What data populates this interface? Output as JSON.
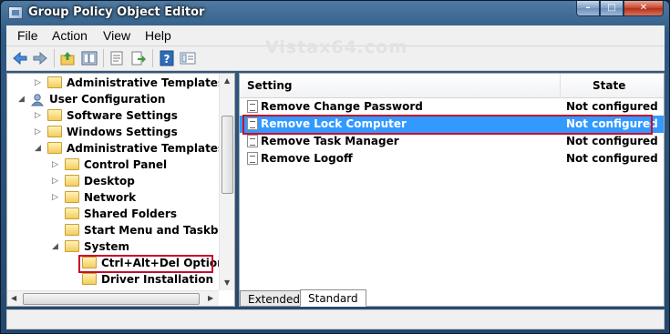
{
  "window": {
    "title": "Group Policy Object Editor",
    "watermark": "Vistax64.com",
    "caption_buttons": {
      "minimize": "–",
      "maximize": "□",
      "close": "✕"
    }
  },
  "menu": [
    "File",
    "Action",
    "View",
    "Help"
  ],
  "toolbar": [
    "back-icon",
    "forward-icon",
    "up-folder-icon",
    "show-hide-tree-icon",
    "properties-icon",
    "export-list-icon",
    "help-icon",
    "extended-view-icon"
  ],
  "tree": {
    "items": [
      {
        "label": "Administrative Templates",
        "expander": "▷",
        "icon": "folder"
      },
      {
        "label": "User Configuration",
        "expander": "◢",
        "icon": "user-config"
      },
      {
        "label": "Software Settings",
        "expander": "▷",
        "icon": "folder"
      },
      {
        "label": "Windows Settings",
        "expander": "▷",
        "icon": "folder"
      },
      {
        "label": "Administrative Templates",
        "expander": "◢",
        "icon": "folder"
      },
      {
        "label": "Control Panel",
        "expander": "▷",
        "icon": "folder"
      },
      {
        "label": "Desktop",
        "expander": "▷",
        "icon": "folder"
      },
      {
        "label": "Network",
        "expander": "▷",
        "icon": "folder"
      },
      {
        "label": "Shared Folders",
        "expander": "",
        "icon": "folder"
      },
      {
        "label": "Start Menu and Taskbar",
        "expander": "",
        "icon": "folder"
      },
      {
        "label": "System",
        "expander": "◢",
        "icon": "folder"
      },
      {
        "label": "Ctrl+Alt+Del Options",
        "expander": "",
        "icon": "folder",
        "highlighted": true
      },
      {
        "label": "Driver Installation",
        "expander": "",
        "icon": "folder"
      }
    ]
  },
  "list": {
    "columns": [
      "Setting",
      "State"
    ],
    "rows": [
      {
        "setting": "Remove Change Password",
        "state": "Not configured"
      },
      {
        "setting": "Remove Lock Computer",
        "state": "Not configured",
        "selected": true
      },
      {
        "setting": "Remove Task Manager",
        "state": "Not configured"
      },
      {
        "setting": "Remove Logoff",
        "state": "Not configured"
      }
    ]
  },
  "tabs": [
    "Extended",
    "Standard"
  ],
  "active_tab": "Standard",
  "colors": {
    "selection": "#3399ff",
    "highlight_box": "#c80d2a"
  }
}
